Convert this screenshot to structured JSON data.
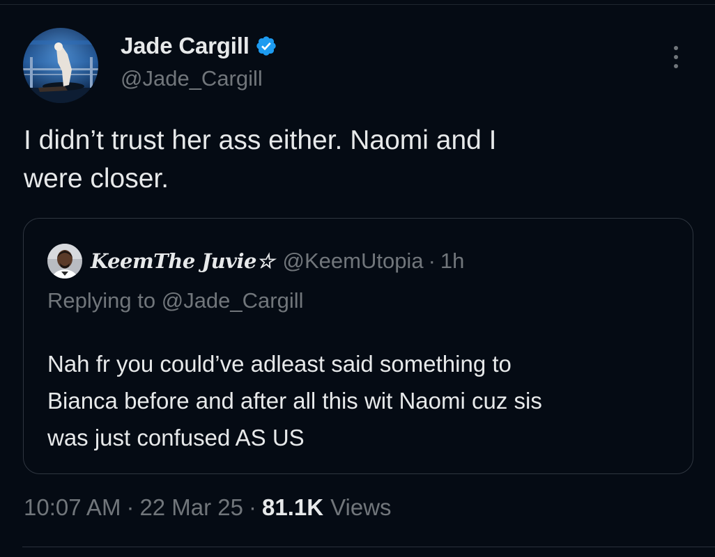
{
  "tweet": {
    "author": {
      "display_name": "Jade Cargill",
      "handle": "@Jade_Cargill",
      "verified": true,
      "verified_color": "#1d9bf0"
    },
    "text": "I didn’t trust her ass either. Naomi and I\nwere closer.",
    "quoted": {
      "display_name": "KeemThe Juvie☆",
      "handle": "@KeemUtopia",
      "separator": "·",
      "time": "1h",
      "replying_prefix": "Replying to ",
      "replying_to": "@Jade_Cargill",
      "text": "Nah fr you could’ve adleast said something to\nBianca before and after all this wit Naomi cuz sis\nwas just confused AS US"
    },
    "meta": {
      "time": "10:07 AM",
      "separator": "·",
      "date": "22 Mar 25",
      "views_count": "81.1K",
      "views_label": "Views"
    }
  },
  "icons": {
    "more": "more-vertical-icon",
    "verified": "verified-badge-icon"
  },
  "colors": {
    "background": "#050b14",
    "text_primary": "#e7e9ea",
    "text_secondary": "#71767b",
    "border": "#2f3640"
  }
}
